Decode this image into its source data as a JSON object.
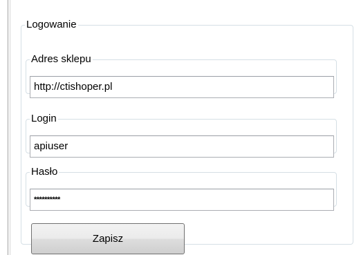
{
  "login_group": {
    "title": "Logowanie",
    "shop_address": {
      "label": "Adres sklepu",
      "value": "http://ctishoper.pl"
    },
    "login": {
      "label": "Login",
      "value": "apiuser"
    },
    "password": {
      "label": "Hasło",
      "value": "**********"
    },
    "save_label": "Zapisz"
  }
}
